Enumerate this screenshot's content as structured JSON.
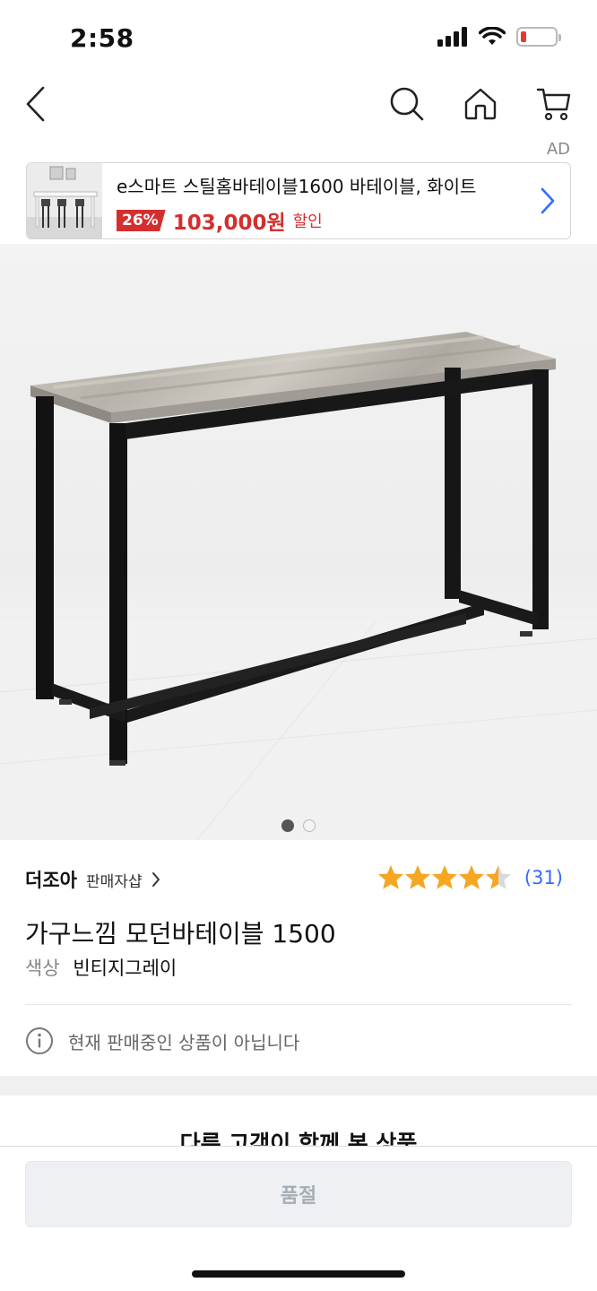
{
  "status_bar": {
    "time": "2:58"
  },
  "nav": {
    "back_icon": "chevron-left-icon",
    "search_icon": "search-icon",
    "home_icon": "home-icon",
    "cart_icon": "cart-icon"
  },
  "ad": {
    "label": "AD",
    "title": "e스마트 스틸홈바테이블1600 바테이블, 화이트",
    "discount": "26%",
    "price": "103,000원",
    "sale_label": "할인"
  },
  "gallery": {
    "page_count": 2,
    "active_index": 0
  },
  "product": {
    "seller_name": "더조아",
    "seller_link": "판매자샵",
    "rating": 4.5,
    "review_count": "(31)",
    "title": "가구느낌 모던바테이블 1500",
    "option_label": "색상",
    "option_value": "빈티지그레이",
    "notice": "현재 판매중인 상품이 아닙니다"
  },
  "related": {
    "title": "다른 고객이 함께 본 상품"
  },
  "bottom": {
    "soldout_label": "품절"
  },
  "colors": {
    "accent_blue": "#346aff",
    "sale_red": "#d32f2f",
    "star_gold": "#f5a623"
  }
}
